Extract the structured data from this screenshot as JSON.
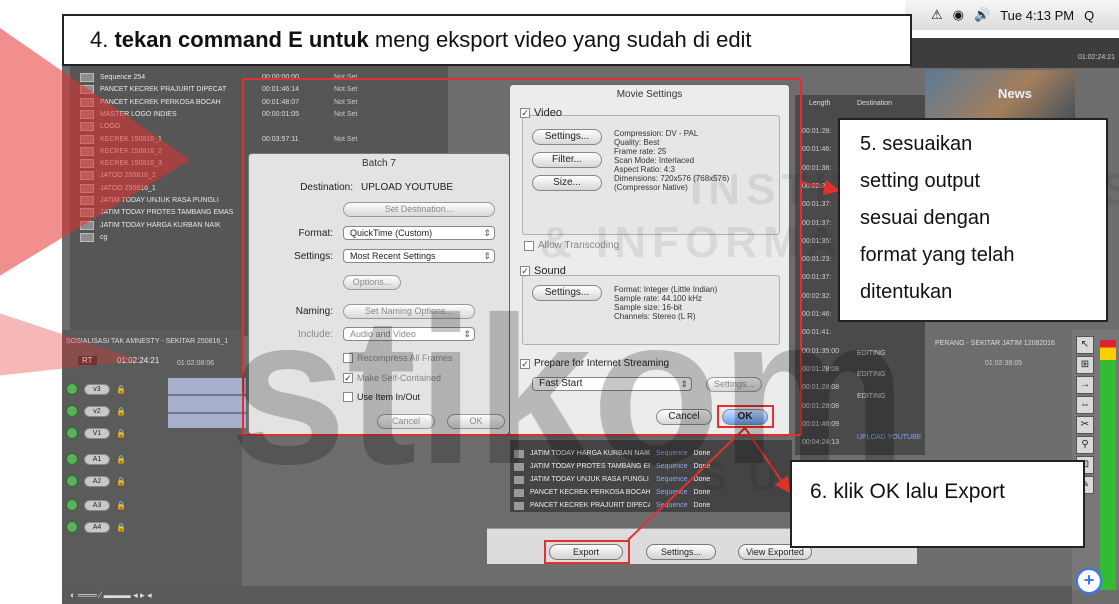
{
  "callouts": {
    "step4_prefix": "4. ",
    "step4_bold": "tekan command E untuk",
    "step4_rest": " meng eksport video yang sudah di edit",
    "step5_lines": [
      "5. sesuaikan",
      "setting output",
      "sesuai dengan",
      "format yang telah",
      "ditentukan"
    ],
    "step6": "6. klik OK lalu Export"
  },
  "menubar": {
    "time": "Tue 4:13 PM",
    "search_icon": "Q"
  },
  "browser_rows": [
    {
      "name": "Sequence 254",
      "tc": "00:00:00:00",
      "status": "Not Set"
    },
    {
      "name": "PANCET KECREK PRAJURIT DIPECAT",
      "tc": "00:01:46:14",
      "status": "Not Set"
    },
    {
      "name": "PANCET KECREK PERKOSA BOCAH",
      "tc": "00:01:48:07",
      "status": "Not Set"
    },
    {
      "name": "MASTER LOGO INDIES",
      "tc": "00:00:01:05",
      "status": "Not Set"
    },
    {
      "name": "LOGO",
      "tc": "",
      "status": ""
    },
    {
      "name": "KECREK 150816_1",
      "tc": "00:03:57:11",
      "status": "Not Set"
    },
    {
      "name": "KECREK 150816_2",
      "tc": "",
      "status": ""
    },
    {
      "name": "KECREK 150816_3",
      "tc": "",
      "status": ""
    },
    {
      "name": "JATOO 250816_2",
      "tc": "",
      "status": ""
    },
    {
      "name": "JATOO 250816_1",
      "tc": "",
      "status": ""
    },
    {
      "name": "JATIM TODAY UNJUK RASA PUNGLI",
      "tc": "",
      "status": ""
    },
    {
      "name": "JATIM TODAY PROTES TAMBANG EMAS",
      "tc": "",
      "status": ""
    },
    {
      "name": "JATIM TODAY HARGA KURBAN NAIK",
      "tc": "",
      "status": ""
    },
    {
      "name": "cg",
      "tc": "",
      "status": ""
    }
  ],
  "batch": {
    "title": "Batch 7",
    "destination_label": "Destination:",
    "destination_value": "UPLOAD YOUTUBE",
    "set_destination": "Set Destination...",
    "format_label": "Format:",
    "format_value": "QuickTime (Custom)",
    "settings_label": "Settings:",
    "settings_value": "Most Recent Settings",
    "options": "Options...",
    "naming_label": "Naming:",
    "naming_button": "Set Naming Options...",
    "include_label": "Include:",
    "include_value": "Audio and Video",
    "recompress": "Recompress All Frames",
    "self_contained": "Make Self-Contained",
    "use_in_out": "Use Item In/Out",
    "cancel": "Cancel",
    "ok": "OK"
  },
  "movie": {
    "title": "Movie Settings",
    "video_label": "Video",
    "settings_btn": "Settings...",
    "filter_btn": "Filter...",
    "size_btn": "Size...",
    "video_info": "Compression: DV - PAL\nQuality: Best\nFrame rate: 25\nScan Mode: Interlaced\nAspect Ratio: 4:3\nDimensions: 720x576 (768x576)\n(Compressor Native)",
    "allow_transcoding": "Allow Transcoding",
    "sound_label": "Sound",
    "sound_settings_btn": "Settings...",
    "sound_info": "Format: Integer (Little Indian)\nSample rate: 44.100 kHz\nSample size: 16-bit\nChannels: Stereo (L R)",
    "streaming_label": "Prepare for Internet Streaming",
    "streaming_value": "Fast Start",
    "streaming_settings": "Settings...",
    "cancel": "Cancel",
    "ok": "OK"
  },
  "export_queue": [
    {
      "name": "JATIM TODAY HARGA KURBAN NAIK",
      "type": "Sequence",
      "status": "Done"
    },
    {
      "name": "JATIM TODAY PROTES TAMBANG EMAS",
      "type": "Sequence",
      "status": "Done"
    },
    {
      "name": "JATIM TODAY UNJUK RASA PUNGLI",
      "type": "Sequence",
      "status": "Done"
    },
    {
      "name": "PANCET KECREK PERKOSA BOCAH",
      "type": "Sequence",
      "status": "Done"
    },
    {
      "name": "PANCET KECREK PRAJURIT DIPECAT",
      "type": "Sequence",
      "status": "Done"
    }
  ],
  "export_bar": {
    "export": "Export",
    "settings": "Settings...",
    "view_exported": "View Exported"
  },
  "right_column": {
    "length_header": "Length",
    "destination_header": "Destination",
    "timecodes": [
      "00:01:28:",
      "00:01:46:",
      "00:01:38:",
      "00:02:32:",
      "00:01:37:",
      "00:01:37:",
      "00:01:35:",
      "00:01:23:",
      "00:01:37:",
      "00:02:32:",
      "00:01:46:",
      "00:01:41:",
      "00:01:35:00",
      "00:01:28:08",
      "00:01:28:08",
      "00:01:28:08",
      "00:01:46:09",
      "00:04:24:13"
    ],
    "editing_1": "EDITING",
    "editing_2": "EDITING",
    "editing_3": "EDITING",
    "upload": "UPLOAD YOUTUBE"
  },
  "viewer": {
    "news": "News",
    "timecode": "01:02:24:21"
  },
  "timeline": {
    "seq_tab": "SOSIALISASI TAK AMNESTY - SEKITAR 250816_1",
    "rt": "RT",
    "timecode": "01:02:24:21",
    "ruler": "01:02:08:06",
    "tracks": [
      "v3",
      "v2",
      "V1",
      "A1",
      "A2",
      "A3",
      "A4"
    ],
    "right_seq": "PERANG - SEKITAR JATIM 12082016",
    "right_ruler": "01:02:38:05"
  },
  "watermark": {
    "line1": "INSTITUT BISNIS",
    "line2": "& INFORMATIKA",
    "big": "stikom",
    "line3": "SURABAYA"
  }
}
